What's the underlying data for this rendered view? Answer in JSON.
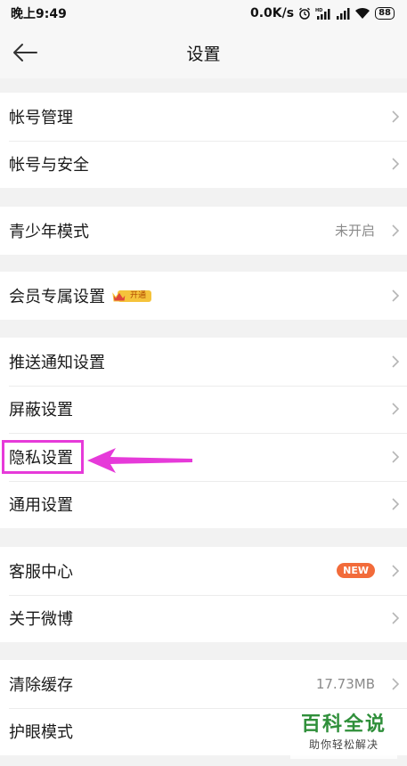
{
  "status_bar": {
    "time": "晚上9:49",
    "network_speed": "0.0K/s",
    "battery": "88",
    "icons": [
      "alarm-icon",
      "signal-hd-icon",
      "signal-icon",
      "wifi-icon",
      "battery-icon"
    ]
  },
  "nav": {
    "title": "设置",
    "back_icon": "back-arrow-icon"
  },
  "groups": {
    "account": {
      "manage": "帐号管理",
      "security": "帐号与安全"
    },
    "youth": {
      "label": "青少年模式",
      "value": "未开启"
    },
    "vip": {
      "label": "会员专属设置",
      "badge_text": "开通"
    },
    "general": {
      "push": "推送通知设置",
      "block": "屏蔽设置",
      "privacy": "隐私设置",
      "common": "通用设置"
    },
    "support": {
      "service": "客服中心",
      "new_badge": "NEW",
      "about": "关于微博"
    },
    "storage": {
      "clear": "清除缓存",
      "cache_size": "17.73MB",
      "eye_mode": "护眼模式"
    }
  },
  "annotation": {
    "highlight_color": "#e63ad9",
    "target": "privacy-settings-row"
  },
  "watermark": {
    "title": "百科全说",
    "subtitle": "助你轻松解决"
  },
  "colors": {
    "background": "#f2f2f2",
    "row_bg": "#ffffff",
    "new_badge": "#f26b3a",
    "vip_gold": "#f5c33b"
  }
}
